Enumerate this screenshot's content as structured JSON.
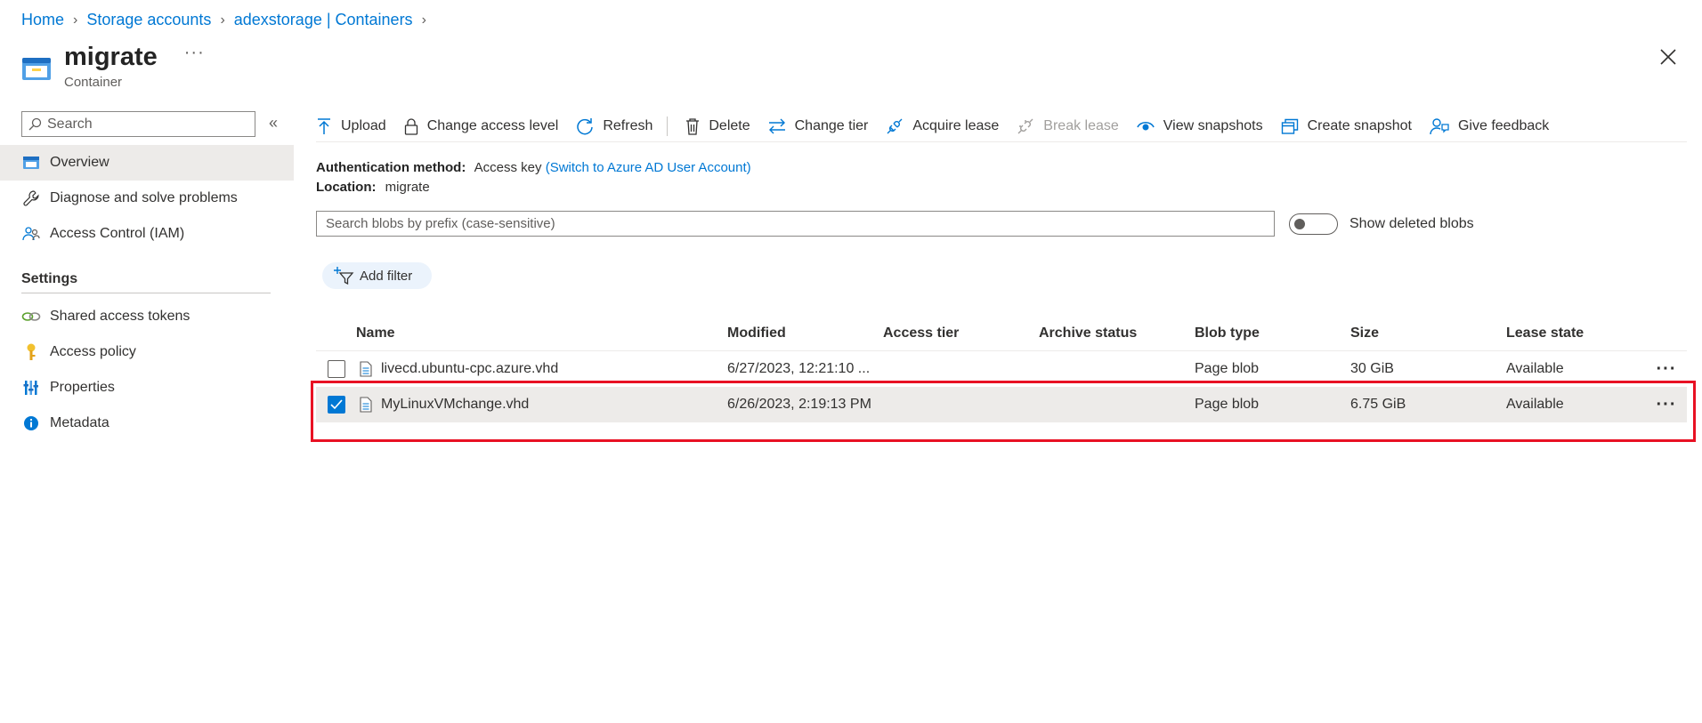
{
  "breadcrumb": {
    "items": [
      "Home",
      "Storage accounts",
      "adexstorage | Containers"
    ]
  },
  "header": {
    "title": "migrate",
    "subtitle": "Container",
    "more": "···"
  },
  "sidebar": {
    "search_placeholder": "Search",
    "collapse": "«",
    "items": [
      {
        "label": "Overview",
        "icon": "overview-icon"
      },
      {
        "label": "Diagnose and solve problems",
        "icon": "wrench-icon"
      },
      {
        "label": "Access Control (IAM)",
        "icon": "people-icon"
      }
    ],
    "settings_label": "Settings",
    "settings_items": [
      {
        "label": "Shared access tokens",
        "icon": "link-icon"
      },
      {
        "label": "Access policy",
        "icon": "key-icon"
      },
      {
        "label": "Properties",
        "icon": "properties-icon"
      },
      {
        "label": "Metadata",
        "icon": "info-icon"
      }
    ]
  },
  "toolbar": {
    "upload": "Upload",
    "change_access": "Change access level",
    "refresh": "Refresh",
    "delete": "Delete",
    "change_tier": "Change tier",
    "acquire_lease": "Acquire lease",
    "break_lease": "Break lease",
    "view_snapshots": "View snapshots",
    "create_snapshot": "Create snapshot",
    "give_feedback": "Give feedback"
  },
  "info": {
    "auth_label": "Authentication method:",
    "auth_value": "Access key",
    "auth_link": "(Switch to Azure AD User Account)",
    "location_label": "Location:",
    "location_value": "migrate"
  },
  "blob_search": {
    "placeholder": "Search blobs by prefix (case-sensitive)",
    "toggle_label": "Show deleted blobs",
    "toggle_on": false
  },
  "filter": {
    "add_filter": "Add filter"
  },
  "table": {
    "columns": [
      "Name",
      "Modified",
      "Access tier",
      "Archive status",
      "Blob type",
      "Size",
      "Lease state"
    ],
    "rows": [
      {
        "name": "livecd.ubuntu-cpc.azure.vhd",
        "modified": "6/27/2023, 12:21:10 ...",
        "access_tier": "",
        "archive_status": "",
        "blob_type": "Page blob",
        "size": "30 GiB",
        "lease_state": "Available",
        "selected": false
      },
      {
        "name": "MyLinuxVMchange.vhd",
        "modified": "6/26/2023, 2:19:13 PM",
        "access_tier": "",
        "archive_status": "",
        "blob_type": "Page blob",
        "size": "6.75 GiB",
        "lease_state": "Available",
        "selected": true
      }
    ],
    "row_more": "···"
  },
  "colors": {
    "accent": "#0078d4",
    "highlight": "#e81123",
    "selected_row": "#edebe9"
  }
}
